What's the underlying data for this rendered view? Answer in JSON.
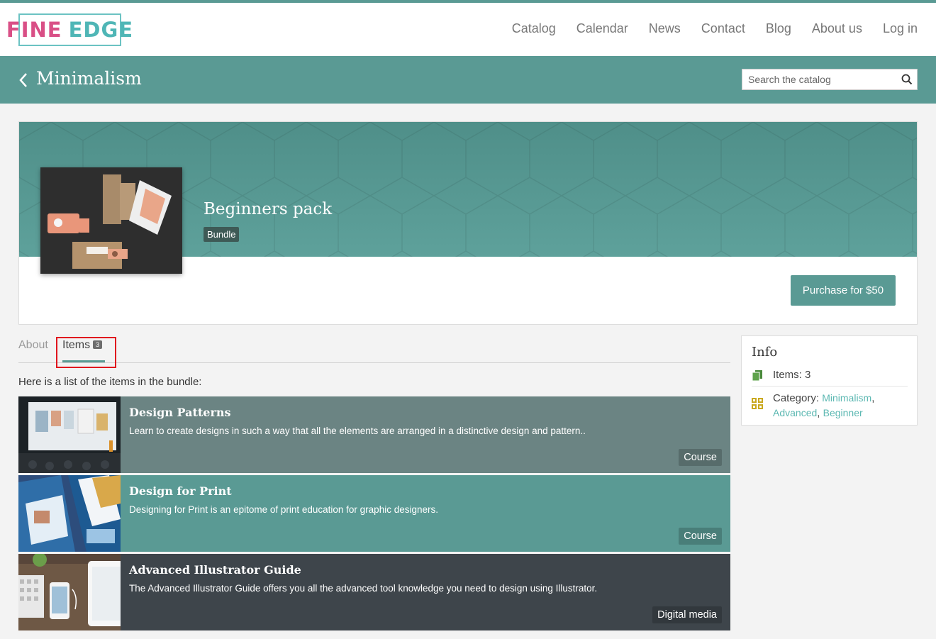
{
  "header": {
    "logo_word1": "FINE",
    "logo_word2": "EDGE",
    "nav": [
      "Catalog",
      "Calendar",
      "News",
      "Contact",
      "Blog",
      "About us",
      "Log in"
    ]
  },
  "titlebar": {
    "title": "Minimalism",
    "search_placeholder": "Search the catalog"
  },
  "hero": {
    "title": "Beginners pack",
    "badge": "Bundle",
    "purchase_label": "Purchase for $50"
  },
  "tabs": {
    "about": "About",
    "items": "Items",
    "items_count": "3"
  },
  "intro": "Here is a list of the items in the bundle:",
  "items": [
    {
      "title": "Design Patterns",
      "desc": "Learn to create designs in such a way that all the elements are arranged in a distinctive design and pattern..",
      "tag": "Course"
    },
    {
      "title": "Design for Print",
      "desc": "Designing for Print is an epitome of print education for graphic designers.",
      "tag": "Course"
    },
    {
      "title": "Advanced Illustrator Guide",
      "desc": "The Advanced Illustrator Guide offers you all the advanced tool knowledge you need to design using Illustrator.",
      "tag": "Digital media"
    }
  ],
  "info": {
    "title": "Info",
    "items_text": "Items: 3",
    "category_label": "Category:",
    "categories": [
      "Minimalism",
      "Advanced",
      "Beginner"
    ],
    "sep": ","
  },
  "colors": {
    "accent": "#5a9a94",
    "logo_pink": "#d94f86",
    "logo_teal": "#4fb6b6",
    "link": "#5cb8b2",
    "dark_item": "#3e454b",
    "highlight": "#e0141e"
  }
}
